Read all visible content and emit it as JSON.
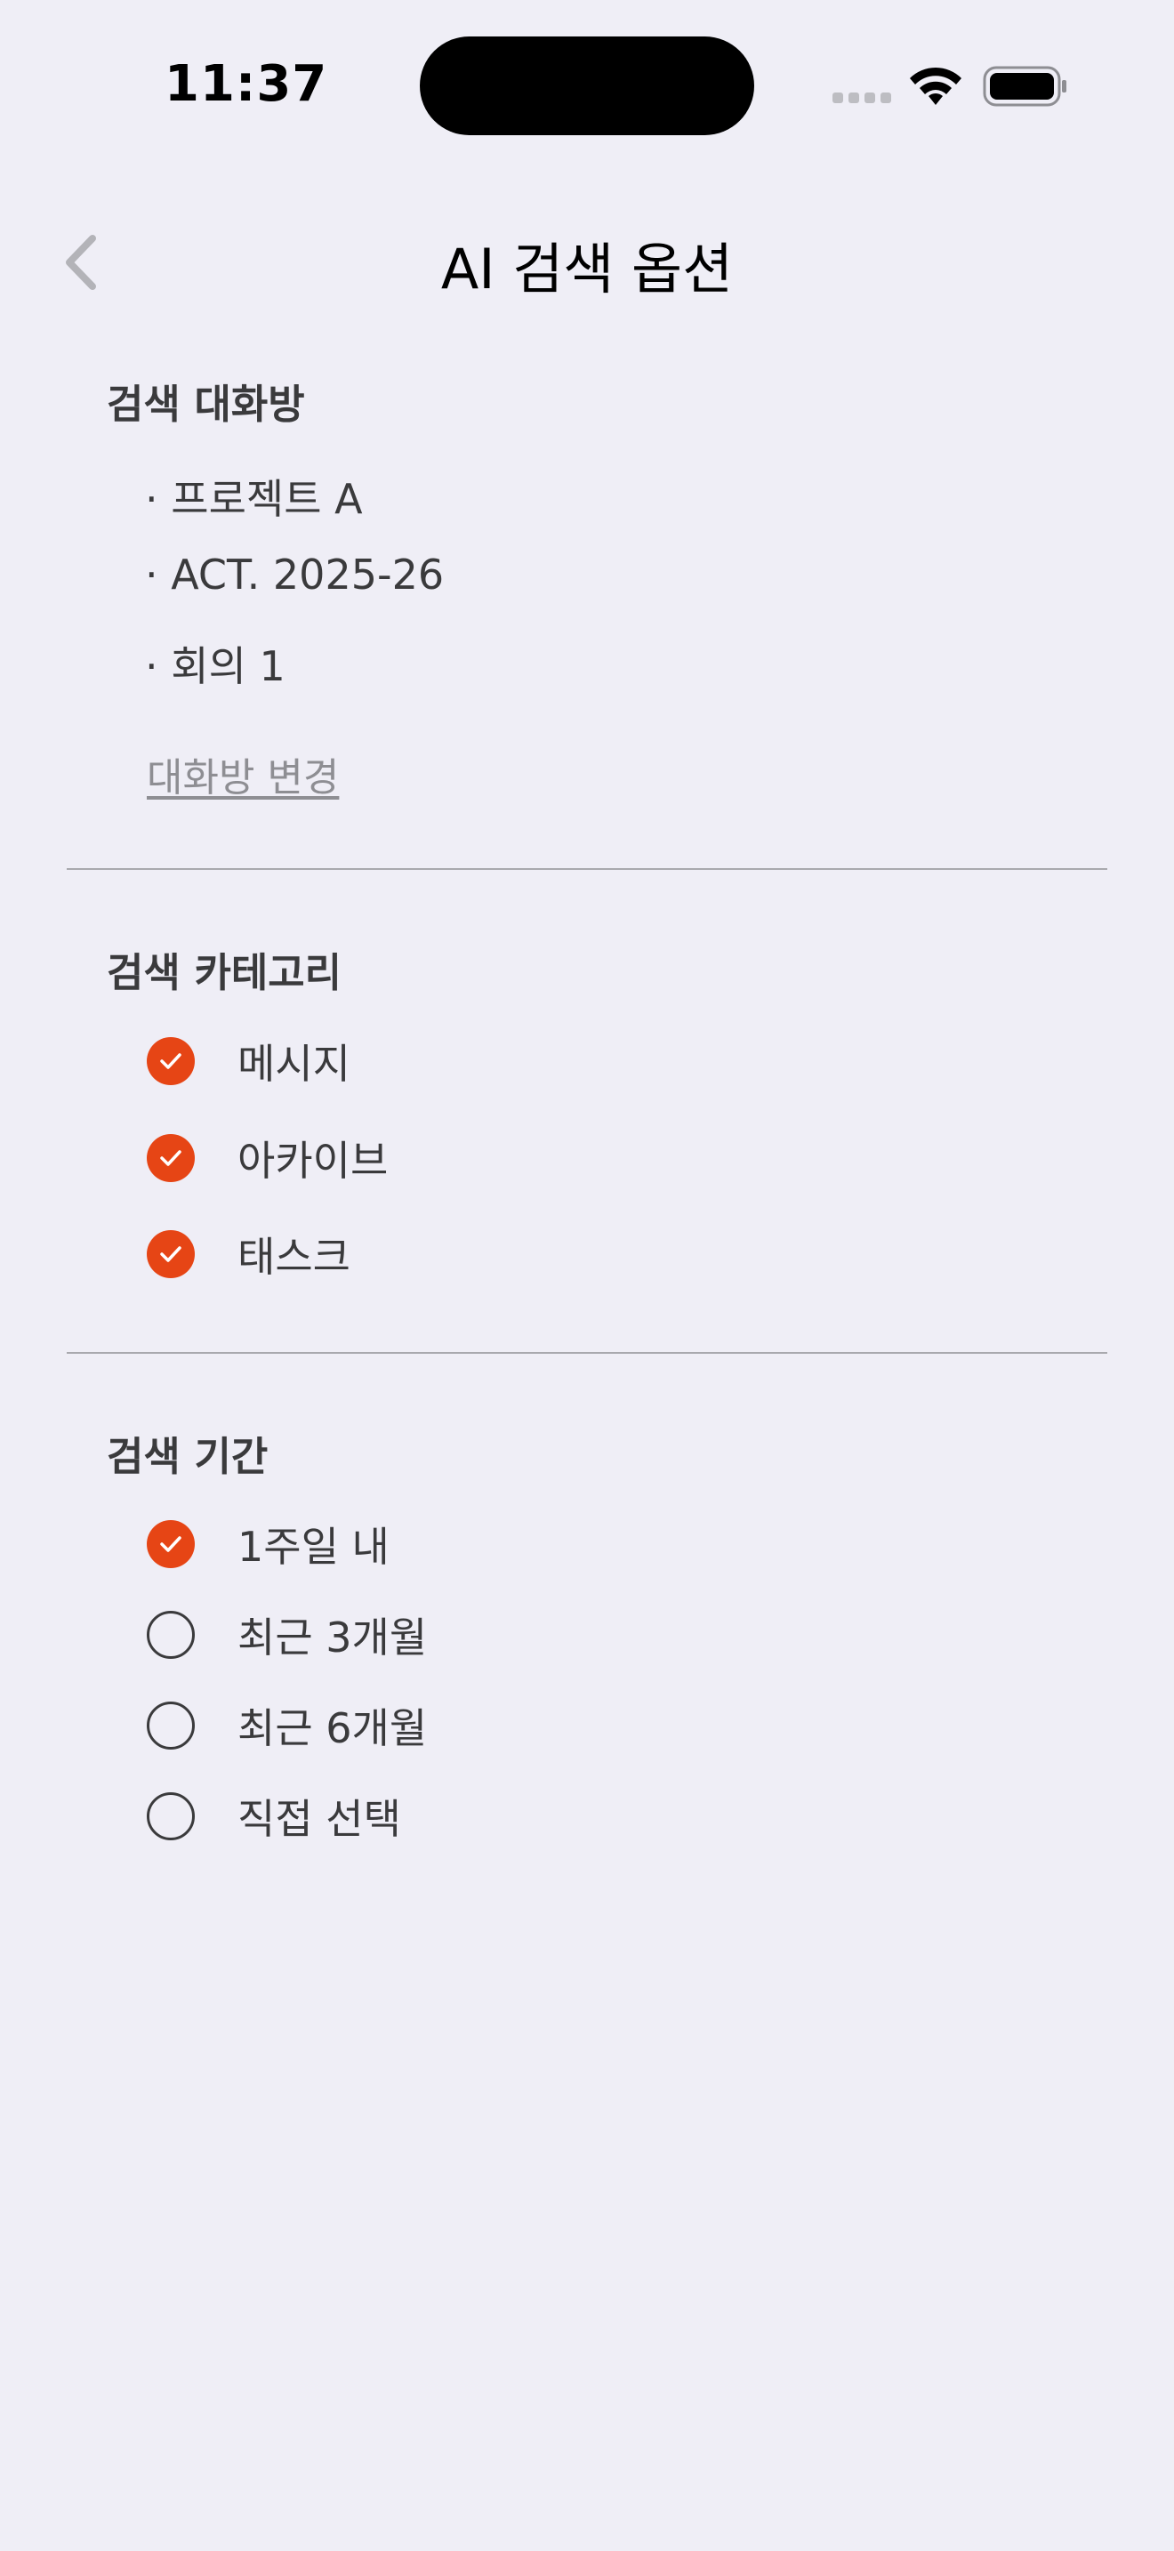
{
  "status_bar": {
    "time": "11:37"
  },
  "nav": {
    "title": "AI 검색 옵션"
  },
  "rooms_section": {
    "title": "검색 대화방",
    "rooms": [
      "· 프로젝트 A",
      "· ACT. 2025-26",
      "· 회의 1"
    ],
    "change_label": "대화방 변경"
  },
  "category_section": {
    "title": "검색 카테고리",
    "options": [
      {
        "label": "메시지",
        "checked": true
      },
      {
        "label": "아카이브",
        "checked": true
      },
      {
        "label": "태스크",
        "checked": true
      }
    ]
  },
  "period_section": {
    "title": "검색 기간",
    "options": [
      {
        "label": "1주일 내",
        "checked": true
      },
      {
        "label": "최근 3개월",
        "checked": false
      },
      {
        "label": "최근 6개월",
        "checked": false
      },
      {
        "label": "직접 선택",
        "checked": false
      }
    ]
  },
  "colors": {
    "accent": "#E64515",
    "background": "#EFEEF6"
  },
  "icons": {
    "back": "chevron-left-icon",
    "check": "checkmark-icon",
    "wifi": "wifi-icon",
    "battery": "battery-icon",
    "signal": "cellular-signal-icon"
  }
}
